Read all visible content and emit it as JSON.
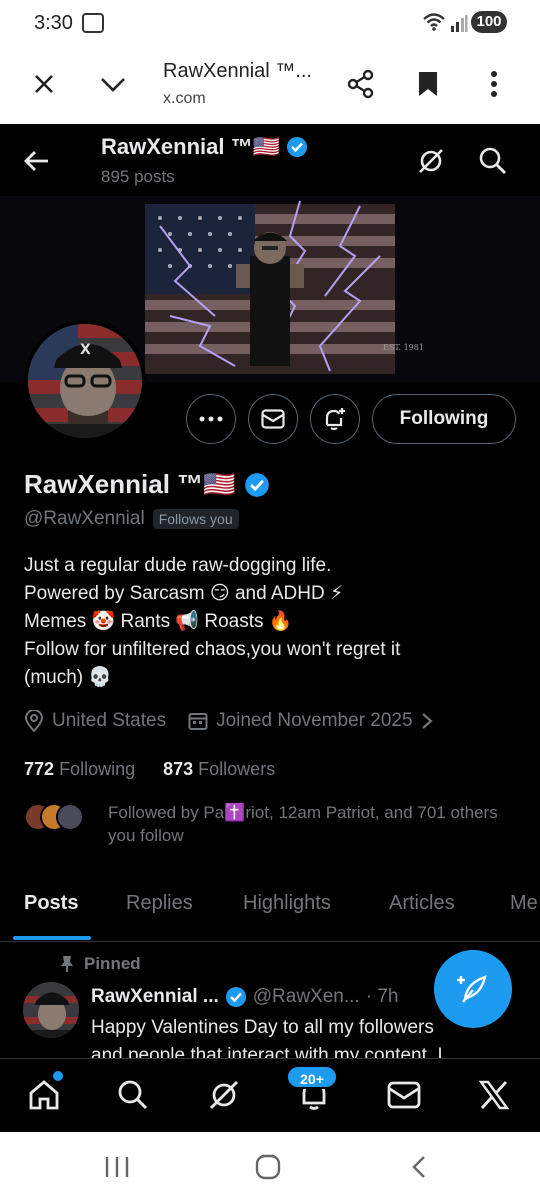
{
  "status_bar": {
    "time": "3:30",
    "battery": "100"
  },
  "browser": {
    "title": "RawXennial ™...",
    "url": "x.com"
  },
  "profile_header": {
    "name": "RawXennial ™🇺🇸",
    "posts_count": "895 posts"
  },
  "banner": {
    "est_text": "EST. 1981"
  },
  "actions": {
    "following_label": "Following"
  },
  "profile": {
    "name": "RawXennial ™🇺🇸",
    "handle": "@RawXennial",
    "follows_you": "Follows you",
    "bio": [
      "Just a regular dude raw-dogging life.",
      "Powered by Sarcasm 😏 and ADHD ⚡",
      "Memes 🤡 Rants 📢 Roasts 🔥",
      "Follow for unfiltered chaos,you won't regret it",
      "(much) 💀"
    ],
    "location": "United States",
    "joined": "Joined November 2025",
    "following_count": "772",
    "following_label": "Following",
    "followers_count": "873",
    "followers_label": "Followers",
    "followed_by": "Followed by Pa✝️riot, 12am Patriot, and 701 others you follow"
  },
  "tabs": [
    "Posts",
    "Replies",
    "Highlights",
    "Articles",
    "Me"
  ],
  "pinned_post": {
    "pinned_label": "Pinned",
    "author": "RawXennial ...",
    "handle": "@RawXen...",
    "time": "· 7h",
    "text_line1": "Happy Valentines Day to all my followers",
    "text_line2": "and people that interact with my content. I"
  },
  "bottom_nav": {
    "notif_badge": "20+"
  },
  "colors": {
    "accent": "#1d9bf0",
    "background": "#000000",
    "text_primary": "#e7e9ea",
    "text_secondary": "#71767b"
  }
}
